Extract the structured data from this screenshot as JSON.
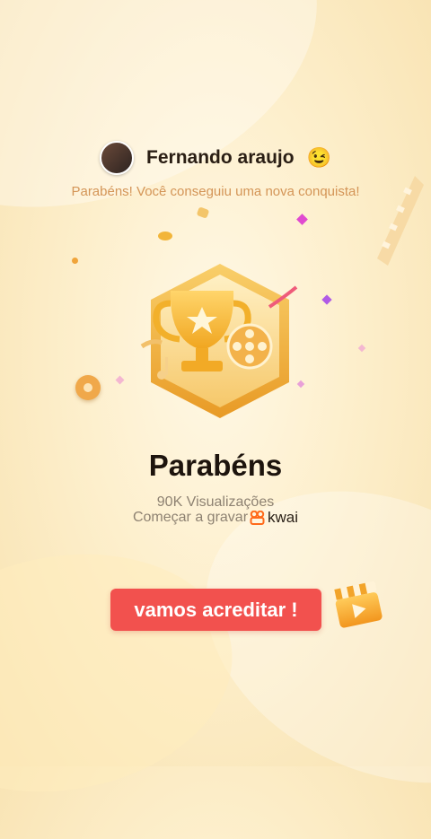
{
  "header": {
    "username": "Fernando araujo",
    "emoji": "😉"
  },
  "subtitle": "Parabéns! Você conseguiu uma nova conquista!",
  "badge": {
    "icon": "trophy-badge-icon"
  },
  "achievement": {
    "title": "Parabéns",
    "views": "90K Visualizações",
    "record_text": "Começar a gravar",
    "brand": "kwai"
  },
  "cta": {
    "label": "vamos acreditar !"
  },
  "colors": {
    "accent": "#f2514e",
    "subtitle": "#d49557",
    "badge_gold": "#f5b73a"
  }
}
